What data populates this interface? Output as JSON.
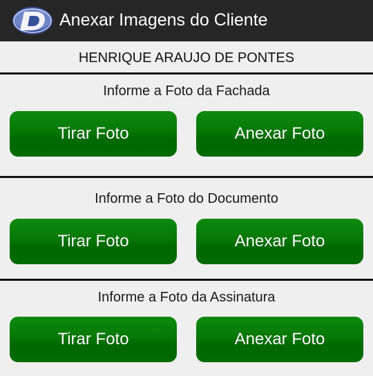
{
  "app_bar": {
    "title": "Anexar Imagens do Cliente",
    "logo_icon": "app-logo-d-icon"
  },
  "client": {
    "name": "HENRIQUE ARAUJO DE PONTES"
  },
  "sections": [
    {
      "label": "Informe a Foto da Fachada",
      "take_photo_label": "Tirar Foto",
      "attach_photo_label": "Anexar Foto"
    },
    {
      "label": "Informe a Foto do Documento",
      "take_photo_label": "Tirar Foto",
      "attach_photo_label": "Anexar Foto"
    },
    {
      "label": "Informe a Foto da Assinatura",
      "take_photo_label": "Tirar Foto",
      "attach_photo_label": "Anexar Foto"
    }
  ],
  "colors": {
    "app_bar": "#262626",
    "background": "#efefef",
    "button_green": "#067806",
    "divider": "#111111"
  }
}
